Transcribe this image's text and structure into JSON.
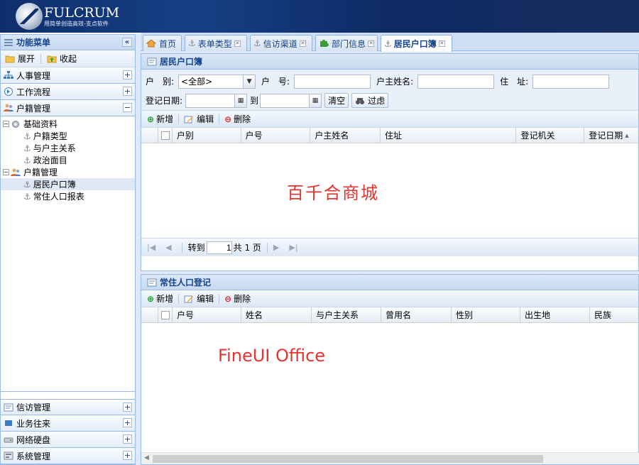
{
  "header": {
    "logo_title": "FULCRUM",
    "logo_sub": "用简单创造高效-支点软件"
  },
  "west": {
    "title": "功能菜单",
    "collapse": "«",
    "expand_label": "展开",
    "collapse_label": "收起",
    "sections_top": [
      {
        "label": "人事管理",
        "pm": "+"
      },
      {
        "label": "工作流程",
        "pm": "+"
      },
      {
        "label": "户籍管理",
        "pm": "−"
      }
    ],
    "tree": [
      {
        "label": "基础资料",
        "level": 0,
        "type": "folder"
      },
      {
        "label": "户籍类型",
        "level": 1,
        "type": "leaf"
      },
      {
        "label": "与户主关系",
        "level": 1,
        "type": "leaf"
      },
      {
        "label": "政治面目",
        "level": 1,
        "type": "leaf"
      },
      {
        "label": "户籍管理",
        "level": 0,
        "type": "folder"
      },
      {
        "label": "居民户口簿",
        "level": 1,
        "type": "leaf",
        "selected": true
      },
      {
        "label": "常住人口报表",
        "level": 1,
        "type": "leaf"
      }
    ],
    "sections_bottom": [
      {
        "label": "信访管理",
        "pm": "+"
      },
      {
        "label": "业务往来",
        "pm": "+"
      },
      {
        "label": "网络硬盘",
        "pm": "+"
      },
      {
        "label": "系统管理",
        "pm": "+"
      }
    ]
  },
  "tabs": [
    {
      "label": "首页"
    },
    {
      "label": "表单类型"
    },
    {
      "label": "信访渠道"
    },
    {
      "label": "部门信息"
    },
    {
      "label": "居民户口簿",
      "active": true
    }
  ],
  "panel1": {
    "title": "居民户口簿",
    "form": {
      "hubie_label": "户　别:",
      "hubie_value": "<全部>",
      "huhao_label": "户　号:",
      "huzhu_label": "户主姓名:",
      "address_label": "住　址:",
      "date_label": "登记日期:",
      "to_label": "到",
      "clear_btn": "清空",
      "filter_btn": "过虑"
    },
    "toolbar": {
      "add": "新增",
      "edit": "编辑",
      "delete": "删除"
    },
    "columns": [
      "户别",
      "户号",
      "户主姓名",
      "住址",
      "登记机关",
      "登记日期"
    ],
    "watermark": "百千合商城",
    "pager": {
      "goto": "转到",
      "page": "1",
      "total": "共 1 页"
    }
  },
  "panel2": {
    "title": "常住人口登记",
    "toolbar": {
      "add": "新增",
      "edit": "编辑",
      "delete": "删除"
    },
    "columns": [
      "户号",
      "姓名",
      "与户主关系",
      "曾用名",
      "性别",
      "出生地",
      "民族"
    ],
    "watermark": "FineUI Office"
  },
  "colors": {
    "accent": "#15428b",
    "border": "#99bbe8",
    "watermark": "#e8322d"
  }
}
